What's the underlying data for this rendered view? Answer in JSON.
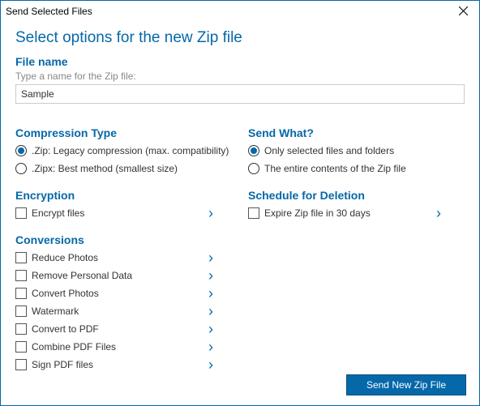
{
  "window": {
    "title": "Send Selected Files"
  },
  "main_title": "Select options for the new Zip file",
  "filename": {
    "heading": "File name",
    "hint": "Type a name for the Zip file:",
    "value": "Sample"
  },
  "compression": {
    "heading": "Compression Type",
    "options": [
      {
        "label": ".Zip: Legacy compression (max. compatibility)",
        "selected": true
      },
      {
        "label": ".Zipx: Best method (smallest size)",
        "selected": false
      }
    ]
  },
  "encryption": {
    "heading": "Encryption",
    "item": "Encrypt files"
  },
  "conversions": {
    "heading": "Conversions",
    "items": [
      "Reduce Photos",
      "Remove Personal Data",
      "Convert Photos",
      "Watermark",
      "Convert to PDF",
      "Combine PDF Files",
      "Sign PDF files"
    ]
  },
  "sendwhat": {
    "heading": "Send What?",
    "options": [
      {
        "label": "Only selected files and folders",
        "selected": true
      },
      {
        "label": "The entire contents of the Zip file",
        "selected": false
      }
    ]
  },
  "schedule": {
    "heading": "Schedule for Deletion",
    "item": "Expire Zip file in 30 days"
  },
  "footer": {
    "button": "Send New Zip File"
  }
}
